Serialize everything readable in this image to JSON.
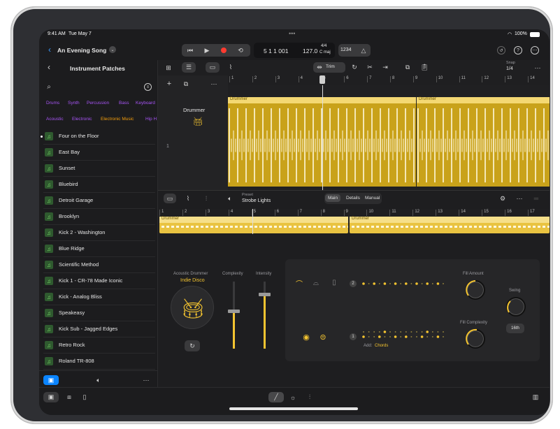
{
  "status": {
    "time": "9:41 AM",
    "date": "Tue May 7",
    "battery": "100%",
    "handle": "•••"
  },
  "header": {
    "title": "An Evening Song",
    "position": "5 1 1 001",
    "tempo": "127.0",
    "signature_top": "4/4",
    "signature_bottom": "C maj",
    "count_in": "1234"
  },
  "toolbar": {
    "trim_label": "Trim",
    "snap_label": "Snap",
    "snap_value": "1/4"
  },
  "sidebar": {
    "title": "Instrument Patches",
    "tags_row1": [
      "Drums",
      "Synth",
      "Percussion",
      "Bass",
      "Keyboard"
    ],
    "tags_row2": [
      "Acoustic",
      "Electronic",
      "Electronic Music",
      "Hip H"
    ],
    "items": [
      {
        "label": "Four on the Floor",
        "selected": true
      },
      {
        "label": "East Bay"
      },
      {
        "label": "Sunset"
      },
      {
        "label": "Bluebird"
      },
      {
        "label": "Detroit Garage"
      },
      {
        "label": "Brooklyn"
      },
      {
        "label": "Kick 2 - Washington"
      },
      {
        "label": "Blue Ridge"
      },
      {
        "label": "Scientific Method"
      },
      {
        "label": "Kick 1 - CR-78 Made Iconic"
      },
      {
        "label": "Kick - Analog Bliss"
      },
      {
        "label": "Speakeasy"
      },
      {
        "label": "Kick Sub - Jagged Edges"
      },
      {
        "label": "Retro Rock"
      },
      {
        "label": "Roland TR-808"
      }
    ]
  },
  "tracks": {
    "ruler_ticks": [
      "1",
      "2",
      "3",
      "4",
      "5",
      "6",
      "7",
      "8",
      "9",
      "10",
      "11",
      "12",
      "13",
      "14"
    ],
    "track_name": "Drummer",
    "track_number": "1",
    "region_label_1": "Drummer",
    "region_label_2": "Drummer"
  },
  "editor": {
    "preset_label": "Preset",
    "preset_value": "Strobe Lights",
    "tabs": [
      "Main",
      "Details",
      "Manual"
    ],
    "ruler_ticks": [
      "1",
      "2",
      "3",
      "4",
      "5",
      "6",
      "7",
      "8",
      "9",
      "10",
      "11",
      "12",
      "13",
      "14",
      "15",
      "16",
      "17"
    ],
    "region_label_1": "Drummer",
    "region_label_2": "Drummer",
    "drummer_type": "Acoustic Drummer",
    "drummer_name": "Indie Disco",
    "complexity_label": "Complexity",
    "intensity_label": "Intensity",
    "row_top_number": "2",
    "row_bottom_number": "1",
    "add_label": "Add:",
    "add_value": "Chords",
    "fill_amount_label": "Fill Amount",
    "fill_complexity_label": "Fill Complexity",
    "swing_label": "Swing",
    "swing_value": "16th"
  }
}
